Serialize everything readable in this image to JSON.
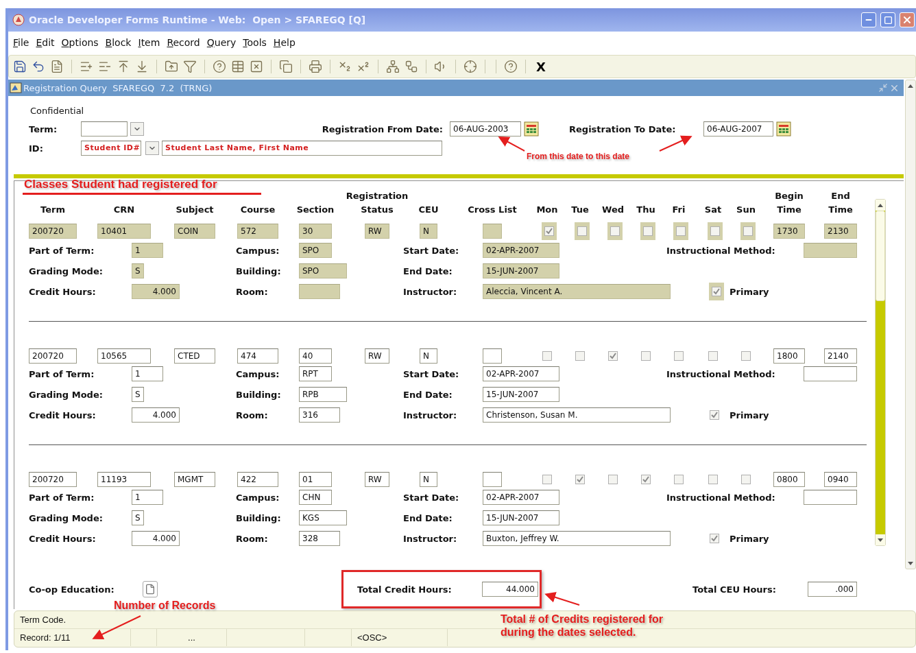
{
  "window": {
    "title": "Oracle Developer Forms Runtime - Web:  Open > SFAREGQ [Q]"
  },
  "menu": [
    "File",
    "Edit",
    "Options",
    "Block",
    "Item",
    "Record",
    "Query",
    "Tools",
    "Help"
  ],
  "toolbar": {
    "exit": "X"
  },
  "form": {
    "title": "Registration Query  SFAREGQ  7.2  (TRNG)",
    "confidential": "Confidential",
    "term_label": "Term:",
    "id_label": "ID:",
    "id_value": "Student ID#",
    "name_value": "Student Last Name, First Name",
    "from_label": "Registration From Date:",
    "from_value": "06-AUG-2003",
    "to_label": "Registration To Date:",
    "to_value": "06-AUG-2007"
  },
  "columns": [
    {
      "lines": [
        "Term"
      ]
    },
    {
      "lines": [
        "CRN"
      ]
    },
    {
      "lines": [
        "Subject"
      ]
    },
    {
      "lines": [
        "Course"
      ]
    },
    {
      "lines": [
        "Section"
      ]
    },
    {
      "lines": [
        "Registration",
        "Status"
      ]
    },
    {
      "lines": [
        "CEU"
      ]
    },
    {
      "lines": [
        "Cross List"
      ]
    },
    {
      "lines": [
        "Mon"
      ]
    },
    {
      "lines": [
        "Tue"
      ]
    },
    {
      "lines": [
        "Wed"
      ]
    },
    {
      "lines": [
        "Thu"
      ]
    },
    {
      "lines": [
        "Fri"
      ]
    },
    {
      "lines": [
        "Sat"
      ]
    },
    {
      "lines": [
        "Sun"
      ]
    },
    {
      "lines": [
        "Begin",
        "Time"
      ]
    },
    {
      "lines": [
        "End",
        "Time"
      ]
    }
  ],
  "records": [
    {
      "selected": true,
      "cells": [
        {
          "kind": "text",
          "value": "200720"
        },
        {
          "kind": "text",
          "value": "10401"
        },
        {
          "kind": "text",
          "value": "COIN"
        },
        {
          "kind": "text",
          "value": "572"
        },
        {
          "kind": "text",
          "value": "30"
        },
        {
          "kind": "text",
          "value": "RW"
        },
        {
          "kind": "text",
          "value": "N"
        },
        {
          "kind": "text"
        },
        {
          "kind": "check",
          "checked": true
        },
        {
          "kind": "check",
          "checked": false
        },
        {
          "kind": "check",
          "checked": false
        },
        {
          "kind": "check",
          "checked": false
        },
        {
          "kind": "check",
          "checked": false
        },
        {
          "kind": "check",
          "checked": false
        },
        {
          "kind": "check",
          "checked": false
        },
        {
          "kind": "text",
          "value": "1730"
        },
        {
          "kind": "text",
          "value": "2130"
        }
      ],
      "details": [
        [
          {
            "label": "Part of Term:",
            "value": "1"
          },
          {
            "label": "Campus:",
            "value": "SPO"
          },
          {
            "label": "Start Date:",
            "value": "02-APR-2007"
          },
          {
            "label": "Instructional Method:"
          }
        ],
        [
          {
            "label": "Grading Mode:",
            "value": "S"
          },
          {
            "label": "Building:",
            "value": "SPO"
          },
          {
            "label": "End Date:",
            "value": "15-JUN-2007"
          }
        ],
        [
          {
            "label": "Credit Hours:",
            "value": "4.000"
          },
          {
            "label": "Room:"
          },
          {
            "label": "Instructor:",
            "value": "Aleccia, Vincent A."
          }
        ]
      ],
      "primary": {
        "label": "Primary",
        "checked": true
      }
    },
    {
      "selected": false,
      "cells": [
        {
          "kind": "text",
          "value": "200720"
        },
        {
          "kind": "text",
          "value": "10565"
        },
        {
          "kind": "text",
          "value": "CTED"
        },
        {
          "kind": "text",
          "value": "474"
        },
        {
          "kind": "text",
          "value": "40"
        },
        {
          "kind": "text",
          "value": "RW"
        },
        {
          "kind": "text",
          "value": "N"
        },
        {
          "kind": "text"
        },
        {
          "kind": "check",
          "checked": false
        },
        {
          "kind": "check",
          "checked": false
        },
        {
          "kind": "check",
          "checked": true
        },
        {
          "kind": "check",
          "checked": false
        },
        {
          "kind": "check",
          "checked": false
        },
        {
          "kind": "check",
          "checked": false
        },
        {
          "kind": "check",
          "checked": false
        },
        {
          "kind": "text",
          "value": "1800"
        },
        {
          "kind": "text",
          "value": "2140"
        }
      ],
      "details": [
        [
          {
            "label": "Part of Term:",
            "value": "1"
          },
          {
            "label": "Campus:",
            "value": "RPT"
          },
          {
            "label": "Start Date:",
            "value": "02-APR-2007"
          },
          {
            "label": "Instructional Method:"
          }
        ],
        [
          {
            "label": "Grading Mode:",
            "value": "S"
          },
          {
            "label": "Building:",
            "value": "RPB"
          },
          {
            "label": "End Date:",
            "value": "15-JUN-2007"
          }
        ],
        [
          {
            "label": "Credit Hours:",
            "value": "4.000"
          },
          {
            "label": "Room:",
            "value": "316"
          },
          {
            "label": "Instructor:",
            "value": "Christenson, Susan M."
          }
        ]
      ],
      "primary": {
        "label": "Primary",
        "checked": true
      }
    },
    {
      "selected": false,
      "cells": [
        {
          "kind": "text",
          "value": "200720"
        },
        {
          "kind": "text",
          "value": "11193"
        },
        {
          "kind": "text",
          "value": "MGMT"
        },
        {
          "kind": "text",
          "value": "422"
        },
        {
          "kind": "text",
          "value": "01"
        },
        {
          "kind": "text",
          "value": "RW"
        },
        {
          "kind": "text",
          "value": "N"
        },
        {
          "kind": "text"
        },
        {
          "kind": "check",
          "checked": false
        },
        {
          "kind": "check",
          "checked": true
        },
        {
          "kind": "check",
          "checked": false
        },
        {
          "kind": "check",
          "checked": true
        },
        {
          "kind": "check",
          "checked": false
        },
        {
          "kind": "check",
          "checked": false
        },
        {
          "kind": "check",
          "checked": false
        },
        {
          "kind": "text",
          "value": "0800"
        },
        {
          "kind": "text",
          "value": "0940"
        }
      ],
      "details": [
        [
          {
            "label": "Part of Term:",
            "value": "1"
          },
          {
            "label": "Campus:",
            "value": "CHN"
          },
          {
            "label": "Start Date:",
            "value": "02-APR-2007"
          },
          {
            "label": "Instructional Method:"
          }
        ],
        [
          {
            "label": "Grading Mode:",
            "value": "S"
          },
          {
            "label": "Building:",
            "value": "KGS"
          },
          {
            "label": "End Date:",
            "value": "15-JUN-2007"
          }
        ],
        [
          {
            "label": "Credit Hours:",
            "value": "4.000"
          },
          {
            "label": "Room:",
            "value": "328"
          },
          {
            "label": "Instructor:",
            "value": "Buxton, Jeffrey W."
          }
        ]
      ],
      "primary": {
        "label": "Primary",
        "checked": true
      }
    }
  ],
  "footer": {
    "coop_label": "Co-op Education:",
    "total_credit_label": "Total Credit Hours:",
    "total_credit_value": "44.000",
    "total_ceu_label": "Total CEU Hours:",
    "total_ceu_value": ".000"
  },
  "status_bar": {
    "message": "Term Code.",
    "record": "Record: 1/11",
    "ellipsis": "...",
    "mode": "<OSC>"
  },
  "annotations": [
    {
      "text": "From this date to this date"
    },
    {
      "text": "Classes Student had registered for"
    },
    {
      "text": "Number of Records"
    },
    {
      "text": "Total # of Credits registered for during the dates selected."
    }
  ]
}
